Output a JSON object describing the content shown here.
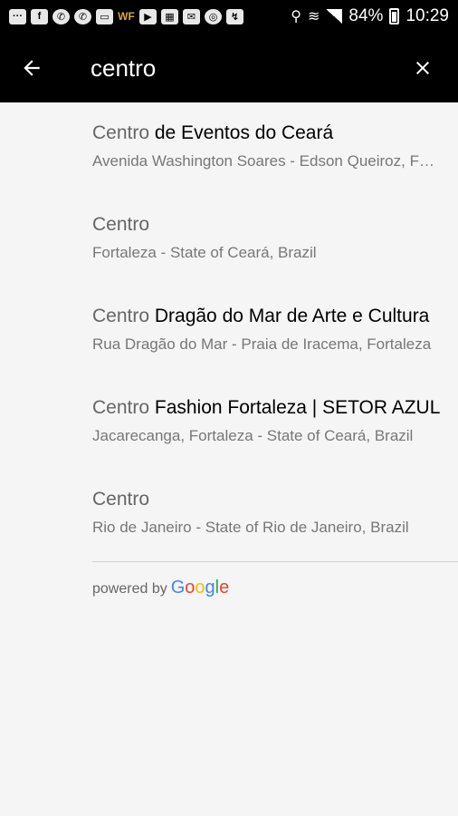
{
  "status_bar": {
    "left_icons": [
      "messages-icon",
      "facebook-icon",
      "whatsapp-icon",
      "whatsapp-icon",
      "sd-card-icon",
      "wf-app-icon",
      "youtube-icon",
      "gallery-icon",
      "email-icon",
      "instagram-icon",
      "sync-icon"
    ],
    "battery": "84%",
    "time": "10:29"
  },
  "app_bar": {
    "search_value": "centro"
  },
  "results": [
    {
      "match": "Centro",
      "rest": " de Eventos do Ceará",
      "secondary": "Avenida Washington Soares - Edson Queiroz, Fortaleza"
    },
    {
      "match": "Centro",
      "rest": "",
      "secondary": "Fortaleza - State of Ceará, Brazil"
    },
    {
      "match": "Centro",
      "rest": " Dragão do Mar de Arte e Cultura",
      "secondary": "Rua Dragão do Mar - Praia de Iracema, Fortaleza"
    },
    {
      "match": "Centro",
      "rest": " Fashion Fortaleza | SETOR AZUL",
      "secondary": "Jacarecanga, Fortaleza - State of Ceará, Brazil"
    },
    {
      "match": "Centro",
      "rest": "",
      "secondary": "Rio de Janeiro - State of Rio de Janeiro, Brazil"
    }
  ],
  "footer": {
    "powered_by": "powered by",
    "brand_letters": [
      {
        "ch": "G",
        "color": "#4285F4"
      },
      {
        "ch": "o",
        "color": "#EA4335"
      },
      {
        "ch": "o",
        "color": "#FBBC05"
      },
      {
        "ch": "g",
        "color": "#4285F4"
      },
      {
        "ch": "l",
        "color": "#34A853"
      },
      {
        "ch": "e",
        "color": "#EA4335"
      }
    ]
  },
  "colors": {
    "toolbar_bg": "#000000",
    "content_bg": "#f5f5f5"
  }
}
